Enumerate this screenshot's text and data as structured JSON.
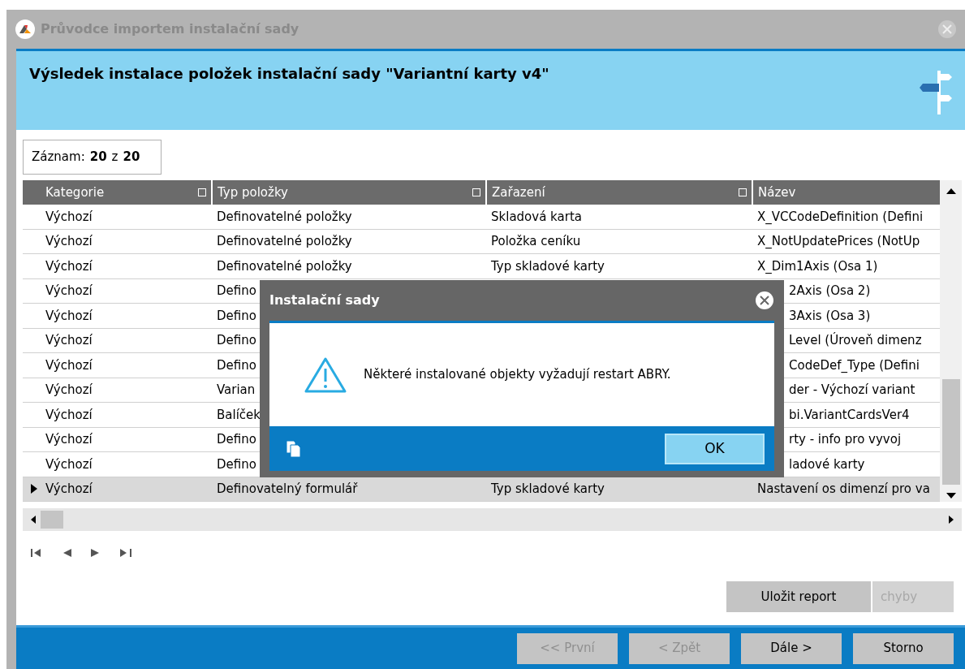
{
  "window": {
    "title": "Průvodce importem instalační sady"
  },
  "header": {
    "title": "Výsledek instalace položek instalační sady \"Variantní karty v4\""
  },
  "record": {
    "label": "Záznam:",
    "current": "20",
    "separator": "z",
    "total": "20"
  },
  "table": {
    "columns": [
      "Kategorie",
      "Typ položky",
      "Zařazení",
      "Název"
    ],
    "rows": [
      {
        "selected": false,
        "cells": [
          "Výchozí",
          "Definovatelné položky",
          "Skladová karta",
          "X_VCCodeDefinition (Defini"
        ]
      },
      {
        "selected": false,
        "cells": [
          "Výchozí",
          "Definovatelné položky",
          "Položka ceníku",
          "X_NotUpdatePrices (NotUp"
        ]
      },
      {
        "selected": false,
        "cells": [
          "Výchozí",
          "Definovatelné položky",
          "Typ skladové karty",
          "X_Dim1Axis (Osa 1)"
        ]
      },
      {
        "selected": false,
        "cells": [
          "Výchozí",
          "Defino",
          null,
          "2Axis (Osa 2)"
        ]
      },
      {
        "selected": false,
        "cells": [
          "Výchozí",
          "Defino",
          null,
          "3Axis (Osa 3)"
        ]
      },
      {
        "selected": false,
        "cells": [
          "Výchozí",
          "Defino",
          null,
          "Level (Úroveň dimenz"
        ]
      },
      {
        "selected": false,
        "cells": [
          "Výchozí",
          "Defino",
          null,
          "CodeDef_Type (Defini"
        ]
      },
      {
        "selected": false,
        "cells": [
          "Výchozí",
          "Varian",
          null,
          "der - Výchozí variant"
        ]
      },
      {
        "selected": false,
        "cells": [
          "Výchozí",
          "Balíček",
          null,
          "bi.VariantCardsVer4"
        ]
      },
      {
        "selected": false,
        "cells": [
          "Výchozí",
          "Defino",
          null,
          "rty - info pro vyvoj"
        ]
      },
      {
        "selected": false,
        "cells": [
          "Výchozí",
          "Defino",
          null,
          "ladové karty"
        ]
      },
      {
        "selected": true,
        "cells": [
          "Výchozí",
          "Definovatelný formulář",
          "Typ skladové karty",
          "Nastavení os dimenzí pro va"
        ]
      }
    ]
  },
  "actions": [
    {
      "label": "Uložit report",
      "disabled": false
    },
    {
      "label": "chyby",
      "disabled": true
    }
  ],
  "footer_buttons": [
    {
      "label": "<< První",
      "disabled": true
    },
    {
      "label": "< Zpět",
      "disabled": true
    },
    {
      "label": "Dále >",
      "disabled": false
    },
    {
      "label": "Storno",
      "disabled": false
    }
  ],
  "dialog": {
    "title": "Instalační sady",
    "message": "Některé instalované objekty vyžadují restart ABRY.",
    "button": "OK"
  }
}
